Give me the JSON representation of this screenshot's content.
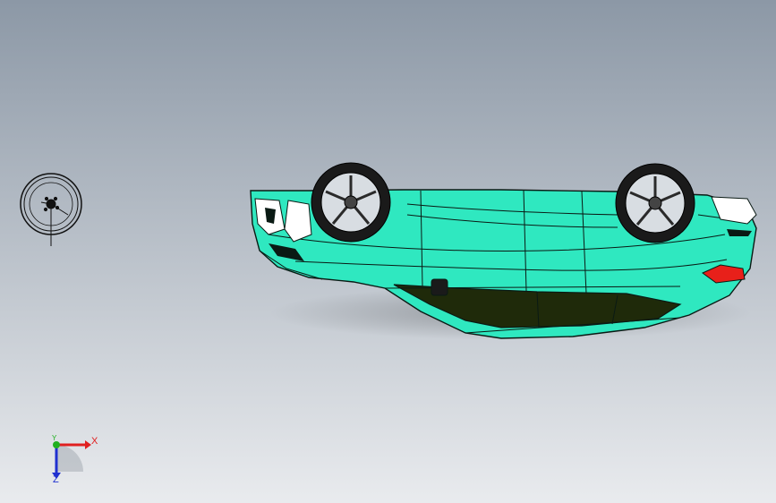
{
  "viewport": {
    "background_top": "#8c98a6",
    "background_bottom": "#e9ebee"
  },
  "model": {
    "name": "car-body-upside-down",
    "body_color": "#2fe8c0",
    "edge_color": "#0a1a14",
    "window_color": "#1f2a0a",
    "taillight_color": "#e8201a",
    "tire_color": "#1a1a1a",
    "rim_color": "#d8dde2"
  },
  "wheel_part": {
    "name": "detached-wheel"
  },
  "triad": {
    "x_label": "X",
    "y_label": "Y",
    "z_label": "Z",
    "x_color": "#e02020",
    "y_color": "#20b020",
    "z_color": "#2030d0"
  }
}
